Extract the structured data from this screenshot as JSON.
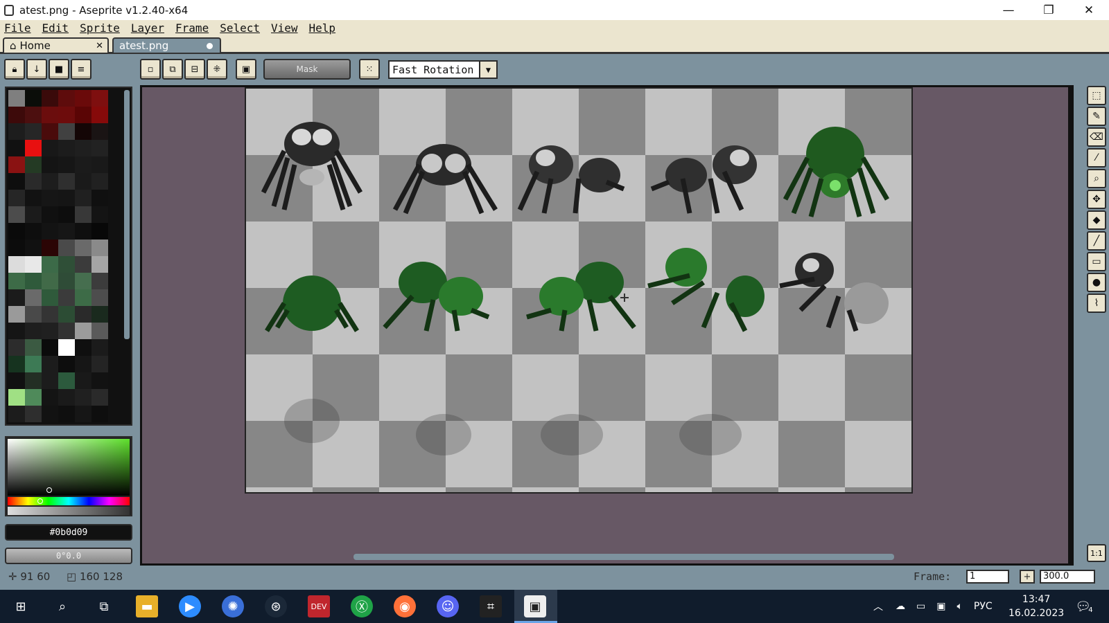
{
  "window": {
    "title": "atest.png - Aseprite v1.2.40-x64",
    "minimize": "—",
    "maximize": "❐",
    "close": "✕"
  },
  "menu": [
    "File",
    "Edit",
    "Sprite",
    "Layer",
    "Frame",
    "Select",
    "View",
    "Help"
  ],
  "tabs": {
    "home": "Home",
    "home_close": "✕",
    "file": "atest.png"
  },
  "context_bar": {
    "mask_label": "Mask",
    "rotation_algorithm": "Fast Rotation"
  },
  "palette": {
    "colors": [
      "#7f7f7f",
      "#0b0d09",
      "#3a0a0a",
      "#5e0c0c",
      "#6a0a0a",
      "#7e0f0f",
      "#3d0a0a",
      "#4c0f0f",
      "#6b0d0d",
      "#6d0c0c",
      "#5a0505",
      "#860a0a",
      "#1d1d1d",
      "#262626",
      "#4a0b0b",
      "#414141",
      "#140606",
      "#1a1414",
      "#111111",
      "#e81010",
      "#181818",
      "#1c1c1c",
      "#1f1f1f",
      "#222222",
      "#8a1212",
      "#243a24",
      "#141414",
      "#161616",
      "#1b1b1b",
      "#191919",
      "#0e0e0e",
      "#2a2a2a",
      "#1d1d1d",
      "#2f2f2f",
      "#1a1a1a",
      "#212121",
      "#262626",
      "#121212",
      "#161616",
      "#151515",
      "#202020",
      "#101010",
      "#4c4c4c",
      "#1b1b1b",
      "#101010",
      "#0d0d0d",
      "#383838",
      "#141414",
      "#0a0a0a",
      "#0e0e0e",
      "#131313",
      "#161616",
      "#0f0f0f",
      "#080808",
      "#0c0c0c",
      "#111111",
      "#2b0505",
      "#4a4a4a",
      "#6a6a6a",
      "#8a8a8a",
      "#dcdcdc",
      "#e8e8e8",
      "#3c6a48",
      "#2f4f37",
      "#3b3b3b",
      "#a5a5a5",
      "#3d6b47",
      "#2f5a3b",
      "#416a48",
      "#2f4c37",
      "#466e4f",
      "#3c3c3c",
      "#1b1b1b",
      "#6a6a6a",
      "#2f5a3b",
      "#3b3b3b",
      "#3d6b47",
      "#4d4d4d",
      "#9a9a9a",
      "#494949",
      "#343434",
      "#2c4c34",
      "#2a2a2a",
      "#1a2a1e",
      "#151515",
      "#1e1e1e",
      "#202020",
      "#323232",
      "#9b9b9b",
      "#5a5a5a",
      "#2c2c2c",
      "#3b5a42",
      "#0b0b0b",
      "#ffffff",
      "#0f0f0f",
      "#1b1b1b",
      "#16331f",
      "#3d7a55",
      "#1c1c1c",
      "#0d0d0d",
      "#161616",
      "#242424",
      "#111111",
      "#232e24",
      "#1c1c1c",
      "#2c5a3d",
      "#191919",
      "#121212",
      "#a0e084",
      "#4f8a5a",
      "#141414",
      "#1a1a1a",
      "#202020",
      "#2a2a2a",
      "#1c1c1c",
      "#2e2e2e",
      "#121212",
      "#0f0f0f",
      "#161616",
      "#0e0e0e"
    ]
  },
  "color": {
    "hex": "#0b0d09",
    "alpha": "0°0.0"
  },
  "status": {
    "position": "91 60",
    "size": "160 128",
    "frame_label": "Frame:",
    "frame_value": "1",
    "zoom": "300.0",
    "plus": "+"
  },
  "taskbar": {
    "language": "РУС",
    "time": "13:47",
    "date": "16.02.2023",
    "notifications": "4"
  },
  "icons": {
    "tools": [
      "marquee-icon",
      "pencil-icon",
      "eraser-icon",
      "eyedropper-icon",
      "zoom-icon",
      "move-icon",
      "bucket-icon",
      "line-icon",
      "rectangle-icon",
      "blur-icon",
      "jumble-icon"
    ]
  }
}
